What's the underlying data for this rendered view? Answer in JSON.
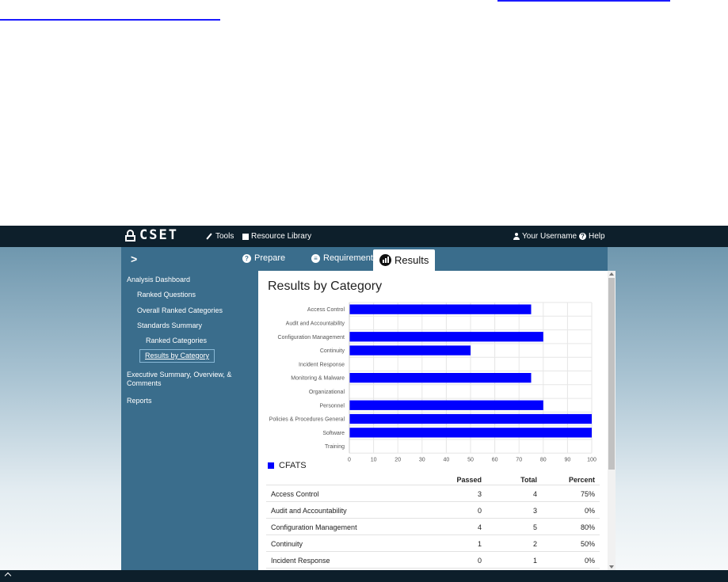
{
  "nav": {
    "logo_text": "CSET",
    "tools_label": "Tools",
    "library_label": "Resource Library",
    "user_label": "Your Username",
    "help_label": "Help"
  },
  "tabs": {
    "toggle_label": ">",
    "prepare_label": "Prepare",
    "requirements_label": "Requirements",
    "results_label": "Results"
  },
  "sidebar": {
    "analysis_dashboard": "Analysis Dashboard",
    "ranked_questions": "Ranked Questions",
    "overall_ranked_categories": "Overall Ranked Categories",
    "standards_summary": "Standards Summary",
    "ranked_categories": "Ranked Categories",
    "results_by_category": "Results by Category",
    "executive_summary_line1": "Executive Summary, Overview, &",
    "executive_summary_line2": "Comments",
    "reports": "Reports"
  },
  "main": {
    "title": "Results by Category",
    "legend_label": "CFATS"
  },
  "chart_data": {
    "type": "bar",
    "orientation": "horizontal",
    "categories": [
      "Access Control",
      "Audit and Accountability",
      "Configuration Management",
      "Continuity",
      "Incident Response",
      "Monitoring & Malware",
      "Organizational",
      "Personnel",
      "Policies & Procedures General",
      "Software",
      "Training"
    ],
    "series": [
      {
        "name": "CFATS",
        "values": [
          75,
          0,
          80,
          50,
          0,
          75,
          0,
          80,
          100,
          100,
          0
        ]
      }
    ],
    "xlim": [
      0,
      100
    ],
    "xticks": [
      "0",
      "10",
      "20",
      "30",
      "40",
      "50",
      "60",
      "70",
      "80",
      "90",
      "100"
    ],
    "grid": true,
    "color": "#0000ff"
  },
  "table": {
    "headers": {
      "name": "",
      "passed": "Passed",
      "total": "Total",
      "percent": "Percent"
    },
    "rows": [
      {
        "name": "Access Control",
        "passed": "3",
        "total": "4",
        "percent": "75%"
      },
      {
        "name": "Audit and Accountability",
        "passed": "0",
        "total": "3",
        "percent": "0%"
      },
      {
        "name": "Configuration Management",
        "passed": "4",
        "total": "5",
        "percent": "80%"
      },
      {
        "name": "Continuity",
        "passed": "1",
        "total": "2",
        "percent": "50%"
      },
      {
        "name": "Incident Response",
        "passed": "0",
        "total": "1",
        "percent": "0%"
      }
    ]
  },
  "colors": {
    "nav_bg": "#0d1f2b",
    "sidebar_bg": "#3a6d8c",
    "bar": "#0000ff",
    "link": "#1a1aff"
  }
}
